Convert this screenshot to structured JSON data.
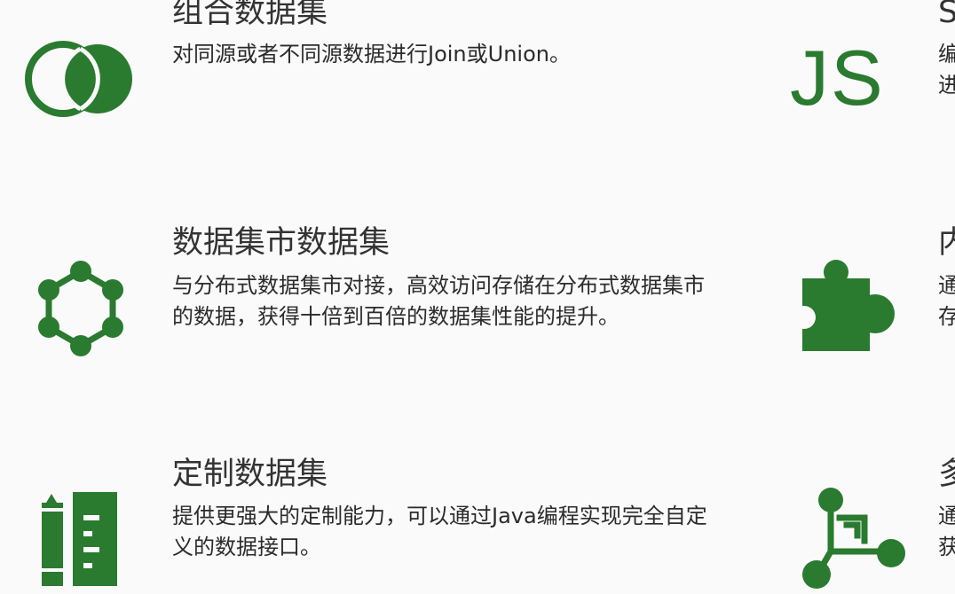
{
  "colors": {
    "accent": "#2a7a2f",
    "background": "#fafafa",
    "text": "#333333"
  },
  "features_left": [
    {
      "icon": "venn-circles-icon",
      "title": "组合数据集",
      "description": "对同源或者不同源数据进行Join或Union。"
    },
    {
      "icon": "hexagon-network-icon",
      "title": "数据集市数据集",
      "description": "与分布式数据集市对接，高效访问存储在分布式数据集市的数据，获得十倍到百倍的数据集性能的提升。"
    },
    {
      "icon": "ruler-pen-icon",
      "title": "定制数据集",
      "description": "提供更强大的定制能力，可以通过Java编程实现完全自定义的数据接口。"
    }
  ],
  "features_right": [
    {
      "icon": "js-icon",
      "icon_text": "JS",
      "title": "S",
      "description_line1": "编",
      "description_line2": "进"
    },
    {
      "icon": "puzzle-piece-icon",
      "title": "内",
      "description_line1": "通",
      "description_line2": "存"
    },
    {
      "icon": "node-graph-icon",
      "title": "多",
      "description_line1": "通",
      "description_line2": "获"
    }
  ]
}
